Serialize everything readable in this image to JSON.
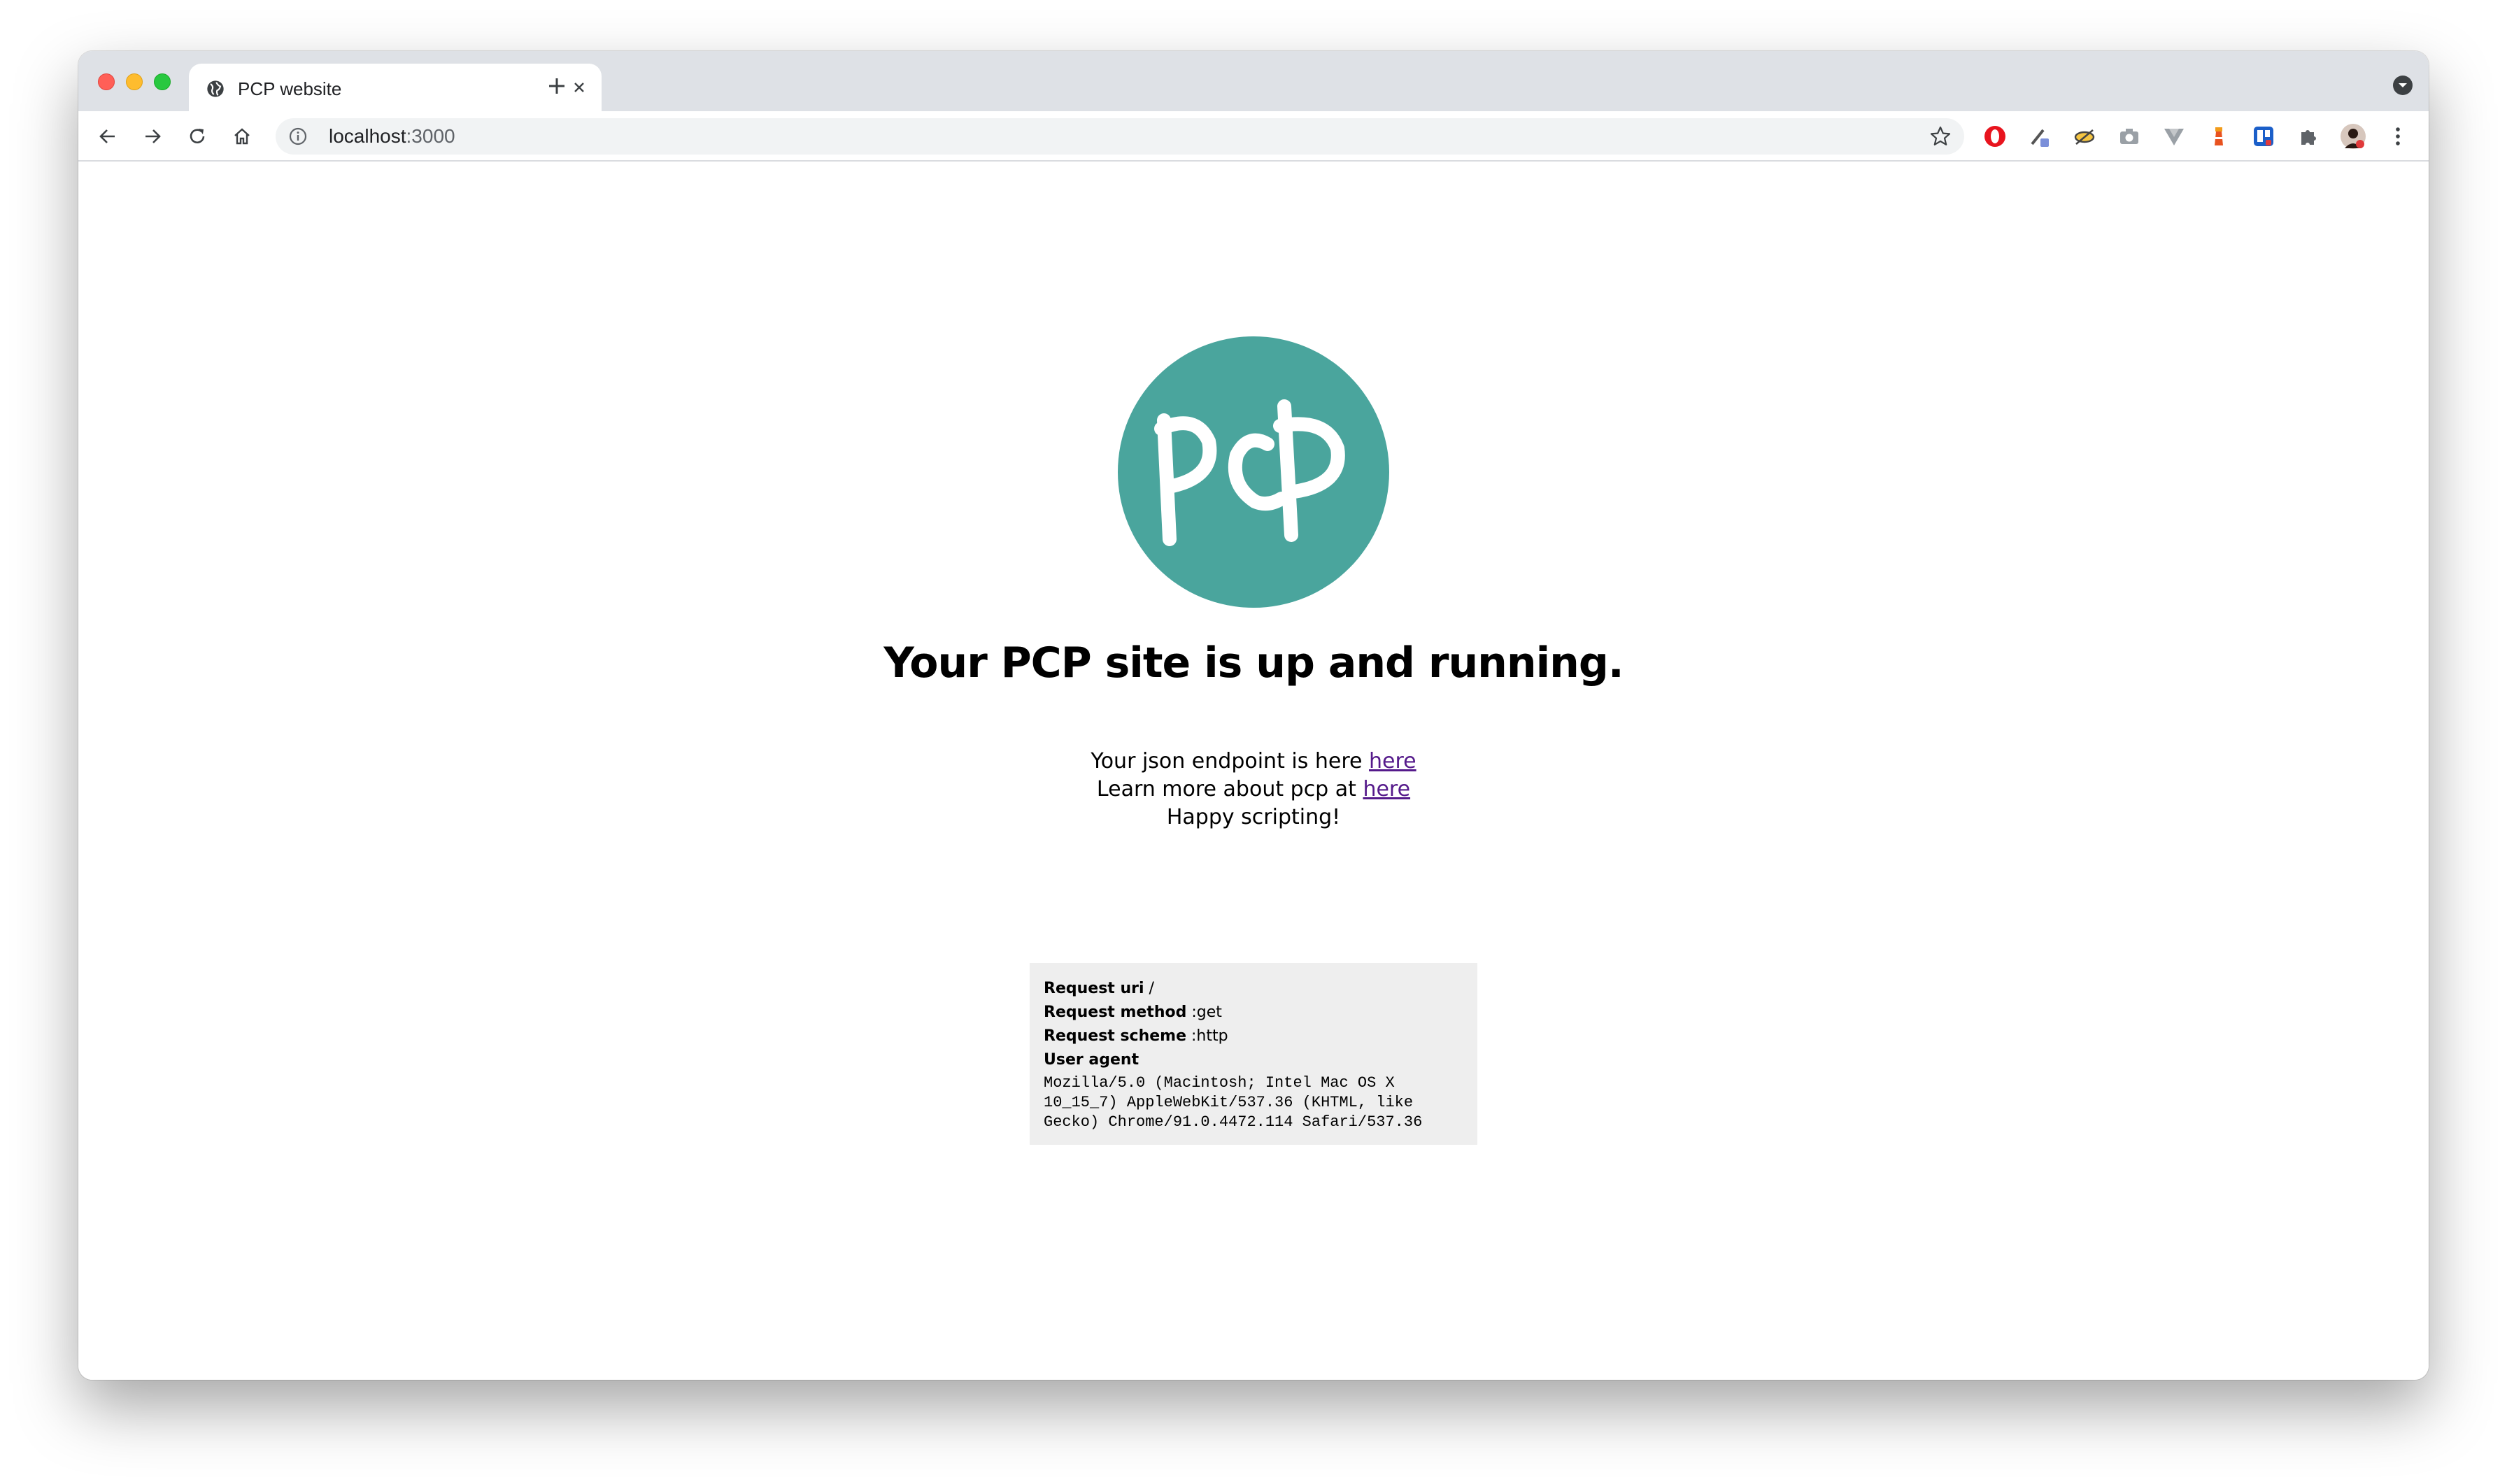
{
  "browser": {
    "tab_title": "PCP website",
    "url_host": "localhost",
    "url_port": ":3000"
  },
  "page": {
    "logo_text": "PCP",
    "headline": "Your PCP site is up and running.",
    "json_line_prefix": "Your json endpoint is here ",
    "json_link": "here",
    "learn_line_prefix": "Learn more about pcp at ",
    "learn_link": "here",
    "happy_line": "Happy scripting!"
  },
  "request": {
    "uri_label": "Request uri",
    "uri_value": " /",
    "method_label": "Request method",
    "method_value": " :get",
    "scheme_label": "Request scheme",
    "scheme_value": " :http",
    "agent_label": "User agent",
    "agent_value": "Mozilla/5.0 (Macintosh; Intel Mac OS X\n10_15_7) AppleWebKit/537.36 (KHTML, like\nGecko) Chrome/91.0.4472.114 Safari/537.36"
  },
  "colors": {
    "logo_teal": "#4aa59d",
    "link_visited": "#551a8b",
    "tabstrip": "#dee1e6"
  },
  "icons": [
    "globe-icon",
    "close-icon",
    "plus-icon",
    "back-arrow-icon",
    "forward-arrow-icon",
    "reload-icon",
    "home-icon",
    "info-icon",
    "star-icon",
    "extension-icons",
    "puzzle-icon",
    "avatar",
    "kebab-menu-icon",
    "tab-search-icon"
  ]
}
